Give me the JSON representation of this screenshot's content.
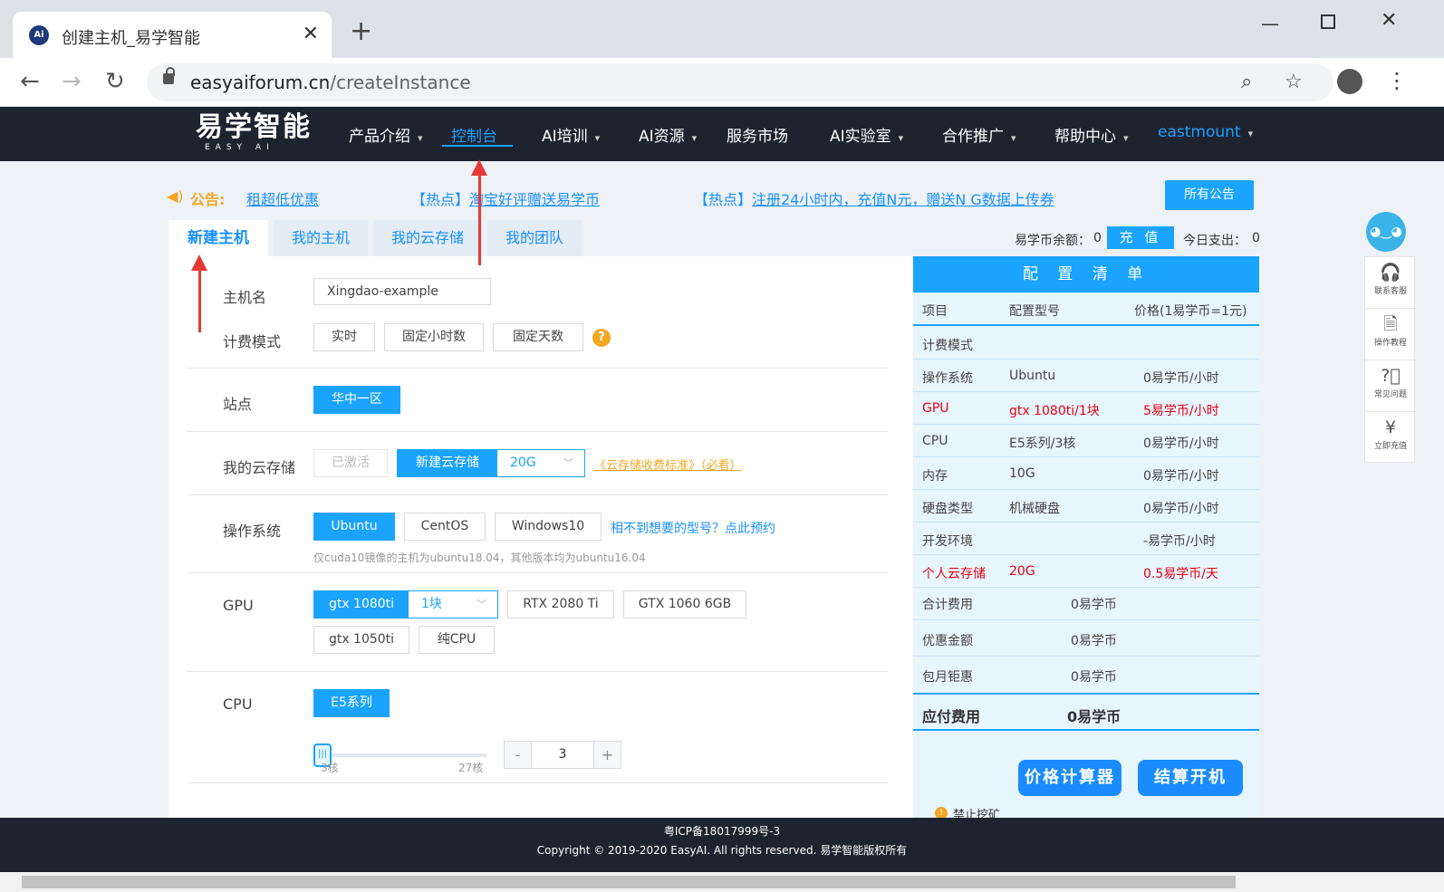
{
  "browser": {
    "tab_title": "创建主机_易学智能",
    "url_domain": "easyaiforum.cn",
    "url_path": "/createInstance"
  },
  "site": {
    "logo_text": "易学智能",
    "logo_sub": "EASY AI",
    "menu": [
      "产品介绍",
      "控制台",
      "AI培训",
      "AI资源",
      "服务市场",
      "AI实验室",
      "合作推广",
      "帮助中心",
      "eastmount"
    ],
    "active_menu": "控制台"
  },
  "announce": {
    "label": "公告:",
    "items": [
      "租超低优惠",
      "【热点】",
      "淘宝好评赠送易学币",
      "【热点】",
      "注册24小时内，充值N元，赠送N G数据上传券"
    ],
    "all_button": "所有公告"
  },
  "tabs": [
    "新建主机",
    "我的主机",
    "我的云存储",
    "我的团队"
  ],
  "balance": {
    "label": "易学币余额：",
    "value": "0",
    "recharge": "充 值",
    "today_label": "今日支出：",
    "today_value": "0"
  },
  "form": {
    "host_label": "主机名",
    "host_value": "Xingdao-example",
    "billing_label": "计费模式",
    "billing_options": [
      "实时",
      "固定小时数",
      "固定天数"
    ],
    "site_label": "站点",
    "site_value": "华中一区",
    "storage_label": "我的云存储",
    "storage_inactive": "已激活",
    "storage_new": "新建云存储",
    "storage_size": "20G",
    "storage_link": "《云存储收费标准》（必看）",
    "os_label": "操作系统",
    "os_options": [
      "Ubuntu",
      "CentOS",
      "Windows10"
    ],
    "os_link": "相不到想要的型号？点此预约",
    "os_note": "仅cuda10镜像的主机为ubuntu18.04，其他版本均为ubuntu16.04",
    "gpu_label": "GPU",
    "gpu_selected": "gtx 1080ti",
    "gpu_count": "1块",
    "gpu_options": [
      "RTX 2080 Ti",
      "GTX 1060 6GB",
      "gtx 1050ti",
      "纯CPU"
    ],
    "cpu_label": "CPU",
    "cpu_selected": "E5系列",
    "cpu_min": "3核",
    "cpu_max": "27核",
    "cpu_value": "3",
    "cpu_slider_fraction": 0.0
  },
  "config": {
    "title": "配 置 清 单",
    "headers": [
      "项目",
      "配置型号",
      "价格(1易学币=1元)"
    ],
    "rows": [
      {
        "item": "计费模式",
        "model": "",
        "price": ""
      },
      {
        "item": "操作系统",
        "model": "Ubuntu",
        "price": "0易学币/小时"
      },
      {
        "item": "GPU",
        "model": "gtx 1080ti/1块",
        "price": "5易学币/小时",
        "red": true
      },
      {
        "item": "CPU",
        "model": "E5系列/3核",
        "price": "0易学币/小时"
      },
      {
        "item": "内存",
        "model": "10G",
        "price": "0易学币/小时"
      },
      {
        "item": "硬盘类型",
        "model": "机械硬盘",
        "price": "0易学币/小时"
      },
      {
        "item": "开发环境",
        "model": "",
        "price": "-易学币/小时"
      },
      {
        "item": "个人云存储",
        "model": "20G",
        "price": "0.5易学币/天",
        "red": true
      }
    ],
    "totals": [
      {
        "label": "合计费用",
        "value": "0易学币"
      },
      {
        "label": "优惠金额",
        "value": "0易学币"
      },
      {
        "label": "包月钜惠",
        "value": "0易学币"
      }
    ],
    "payable_label": "应付费用",
    "payable_value": "0易学币",
    "calc_button": "价格计算器",
    "checkout_button": "结算开机",
    "warning": "禁止挖矿"
  },
  "side": [
    "联系客服",
    "操作教程",
    "常见问题",
    "立即充值"
  ],
  "footer": {
    "icp": "粤ICP备18017999号-3",
    "copyright": "Copyright © 2019-2020 EasyAI. All rights reserved. 易学智能版权所有"
  },
  "colors": {
    "accent": "#1aa3ff",
    "header_bg": "#1e2330",
    "danger": "#e60012",
    "annotation_arrow": "#e53935"
  }
}
